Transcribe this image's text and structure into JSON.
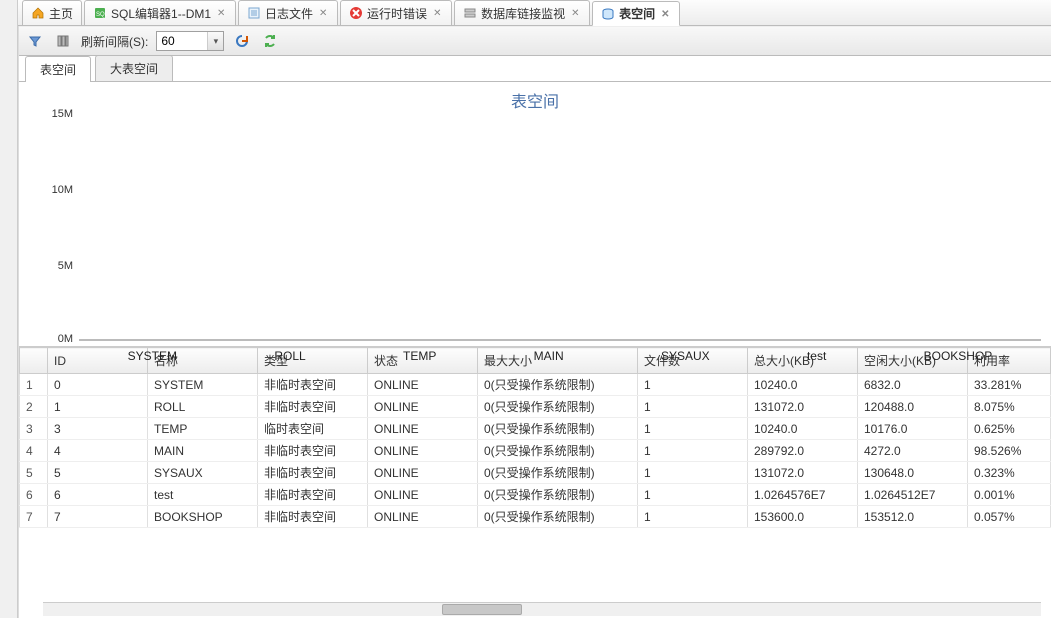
{
  "top_tabs": [
    {
      "label": "主页",
      "icon": "home",
      "closable": false,
      "active": false
    },
    {
      "label": "SQL编辑器1--DM1",
      "icon": "sql",
      "closable": true,
      "active": false
    },
    {
      "label": "日志文件",
      "icon": "log",
      "closable": true,
      "active": false
    },
    {
      "label": "运行时错误",
      "icon": "error",
      "closable": true,
      "active": false
    },
    {
      "label": "数据库链接监视",
      "icon": "dblink",
      "closable": true,
      "active": false
    },
    {
      "label": "表空间",
      "icon": "tablespace",
      "closable": true,
      "active": true
    }
  ],
  "toolbar": {
    "refresh_label_prefix": "刷新间隔(S):",
    "interval_value": "60"
  },
  "sub_tabs": [
    {
      "label": "表空间",
      "active": true
    },
    {
      "label": "大表空间",
      "active": false
    }
  ],
  "chart_data": {
    "type": "bar",
    "title": "表空间",
    "categories": [
      "SYSTEM",
      "ROLL",
      "TEMP",
      "MAIN",
      "SYSAUX",
      "test",
      "BOOKSHOP"
    ],
    "values": [
      0,
      0,
      0,
      0,
      0,
      0,
      0
    ],
    "ylabel": "",
    "xlabel": "",
    "y_ticks": [
      "0M",
      "5M",
      "10M",
      "15M"
    ],
    "ylim": [
      0,
      15000000
    ]
  },
  "table": {
    "headers": [
      "ID",
      "名称",
      "类型",
      "状态",
      "最大大小",
      "文件数",
      "总大小(KB)",
      "空闲大小(KB)",
      "利用率"
    ],
    "rows": [
      {
        "rn": "1",
        "cells": [
          "0",
          "SYSTEM",
          "非临时表空间",
          "ONLINE",
          "0(只受操作系统限制)",
          "1",
          "10240.0",
          "6832.0",
          "33.281%"
        ]
      },
      {
        "rn": "2",
        "cells": [
          "1",
          "ROLL",
          "非临时表空间",
          "ONLINE",
          "0(只受操作系统限制)",
          "1",
          "131072.0",
          "120488.0",
          "8.075%"
        ]
      },
      {
        "rn": "3",
        "cells": [
          "3",
          "TEMP",
          "临时表空间",
          "ONLINE",
          "0(只受操作系统限制)",
          "1",
          "10240.0",
          "10176.0",
          "0.625%"
        ]
      },
      {
        "rn": "4",
        "cells": [
          "4",
          "MAIN",
          "非临时表空间",
          "ONLINE",
          "0(只受操作系统限制)",
          "1",
          "289792.0",
          "4272.0",
          "98.526%"
        ]
      },
      {
        "rn": "5",
        "cells": [
          "5",
          "SYSAUX",
          "非临时表空间",
          "ONLINE",
          "0(只受操作系统限制)",
          "1",
          "131072.0",
          "130648.0",
          "0.323%"
        ]
      },
      {
        "rn": "6",
        "cells": [
          "6",
          "test",
          "非临时表空间",
          "ONLINE",
          "0(只受操作系统限制)",
          "1",
          "1.0264576E7",
          "1.0264512E7",
          "0.001%"
        ]
      },
      {
        "rn": "7",
        "cells": [
          "7",
          "BOOKSHOP",
          "非临时表空间",
          "ONLINE",
          "0(只受操作系统限制)",
          "1",
          "153600.0",
          "153512.0",
          "0.057%"
        ]
      }
    ]
  }
}
